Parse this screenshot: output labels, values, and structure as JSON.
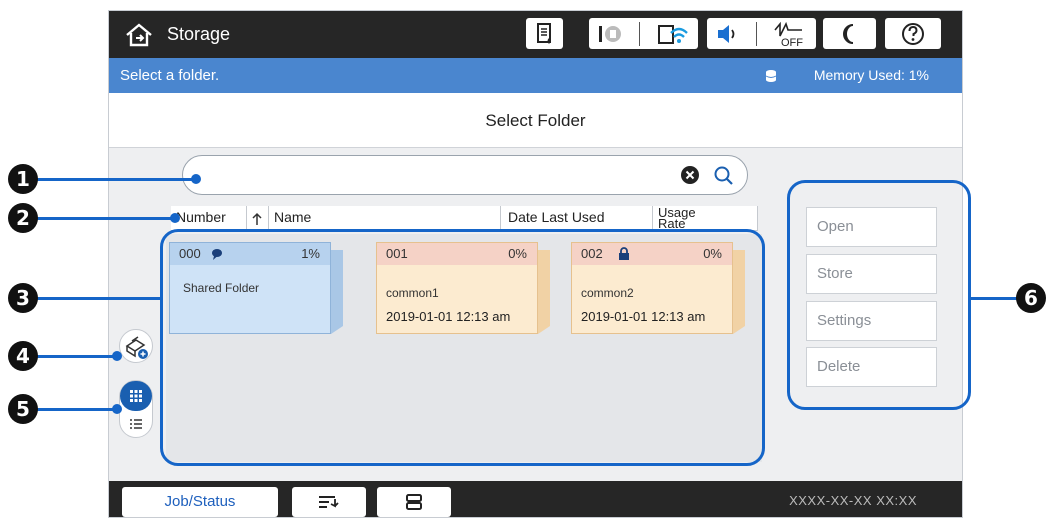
{
  "header": {
    "app_title": "Storage",
    "off_label": "OFF"
  },
  "message_bar": {
    "message": "Select a folder.",
    "memory_used": "Memory Used: 1%"
  },
  "page": {
    "title": "Select Folder"
  },
  "search": {
    "value": "",
    "placeholder": ""
  },
  "columns": {
    "number": "Number",
    "name": "Name",
    "date_last_used": "Date Last Used",
    "usage_rate_line1": "Usage",
    "usage_rate_line2": "Rate"
  },
  "folders": [
    {
      "number": "000",
      "percent": "1%",
      "name": "Shared Folder",
      "date": "",
      "color": "#cfe3f7",
      "hdr_color": "#b7d2ee"
    },
    {
      "number": "001",
      "percent": "0%",
      "name": "common1",
      "date": "2019-01-01 12:13 am",
      "color": "#fcebd0",
      "hdr_color": "#f5d2c6"
    },
    {
      "number": "002",
      "percent": "0%",
      "name": "common2",
      "date": "2019-01-01 12:13 am",
      "color": "#fcebd0",
      "hdr_color": "#f5d2c6"
    }
  ],
  "actions": {
    "open": "Open",
    "store": "Store",
    "settings": "Settings",
    "delete": "Delete"
  },
  "bottom": {
    "job_status": "Job/Status",
    "datetime": "XXXX-XX-XX  XX:XX"
  },
  "callouts": [
    "1",
    "2",
    "3",
    "4",
    "5",
    "6"
  ],
  "colors": {
    "accent": "#4a86cf",
    "callout": "#1565c8",
    "topbar": "#262626"
  }
}
